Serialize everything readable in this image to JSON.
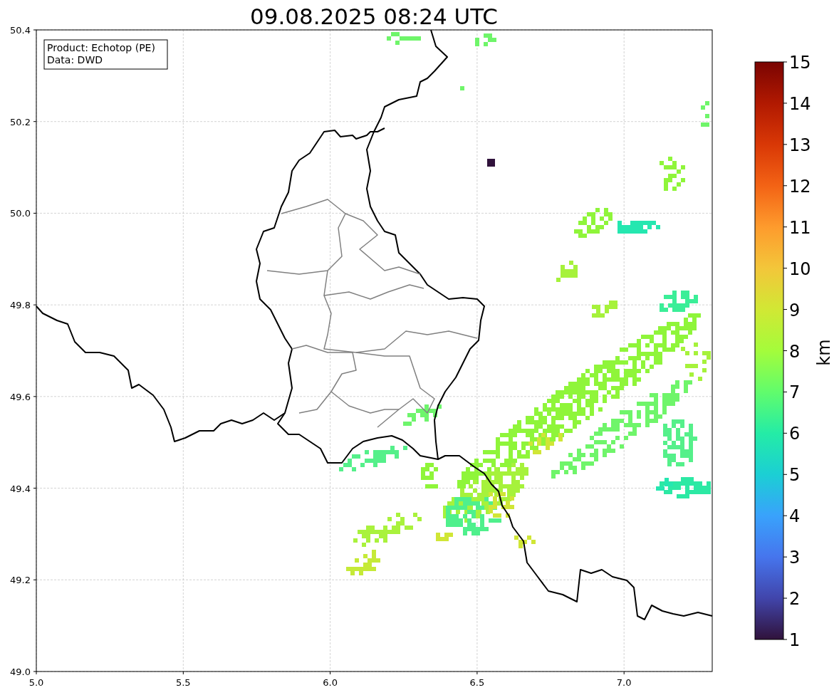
{
  "title": "09.08.2025 08:24 UTC",
  "info_box": {
    "lines": [
      "Product: Echotop (PE)",
      "Data: DWD"
    ]
  },
  "x_axis": {
    "ticks": [
      "5.0",
      "5.5",
      "6.0",
      "6.5",
      "7.0"
    ]
  },
  "y_axis": {
    "ticks": [
      "50.4",
      "50.2",
      "50.0",
      "49.8",
      "49.6",
      "49.4",
      "49.2",
      "49.0"
    ]
  },
  "colorbar": {
    "label": "km",
    "ticks": [
      "15",
      "14",
      "13",
      "12",
      "11",
      "10",
      "9",
      "8",
      "7",
      "6",
      "5",
      "4",
      "3",
      "2",
      "1"
    ]
  }
}
